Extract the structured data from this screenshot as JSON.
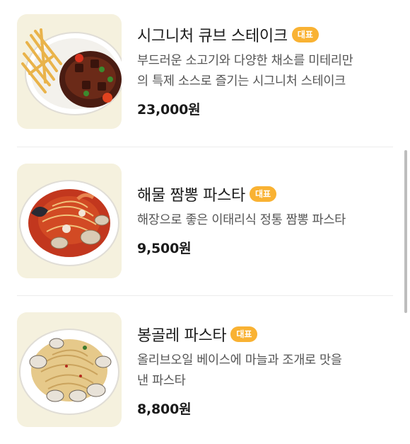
{
  "menu": {
    "items": [
      {
        "name": "시그니처 큐브 스테이크",
        "badge": "대표",
        "description_line1": "부드러운 소고기와 다양한 채소를 미테리만",
        "description_line2": "의 특제 소스로 즐기는 시그니처 스테이크",
        "price": "23,000원",
        "image_icon": "steak-photo"
      },
      {
        "name": "해물 짬뽕 파스타",
        "badge": "대표",
        "description_line1": "해장으로 좋은 이태리식 정통 짬뽕 파스타",
        "description_line2": "",
        "price": "9,500원",
        "image_icon": "seafood-pasta-photo"
      },
      {
        "name": "봉골레 파스타",
        "badge": "대표",
        "description_line1": "올리브오일 베이스에 마늘과 조개로 맛을",
        "description_line2": "낸 파스타",
        "price": "8,800원",
        "image_icon": "vongole-pasta-photo"
      }
    ]
  },
  "colors": {
    "badge": "#f9b233",
    "thumb_bg": "#f5f1de",
    "divider": "#ececec"
  }
}
